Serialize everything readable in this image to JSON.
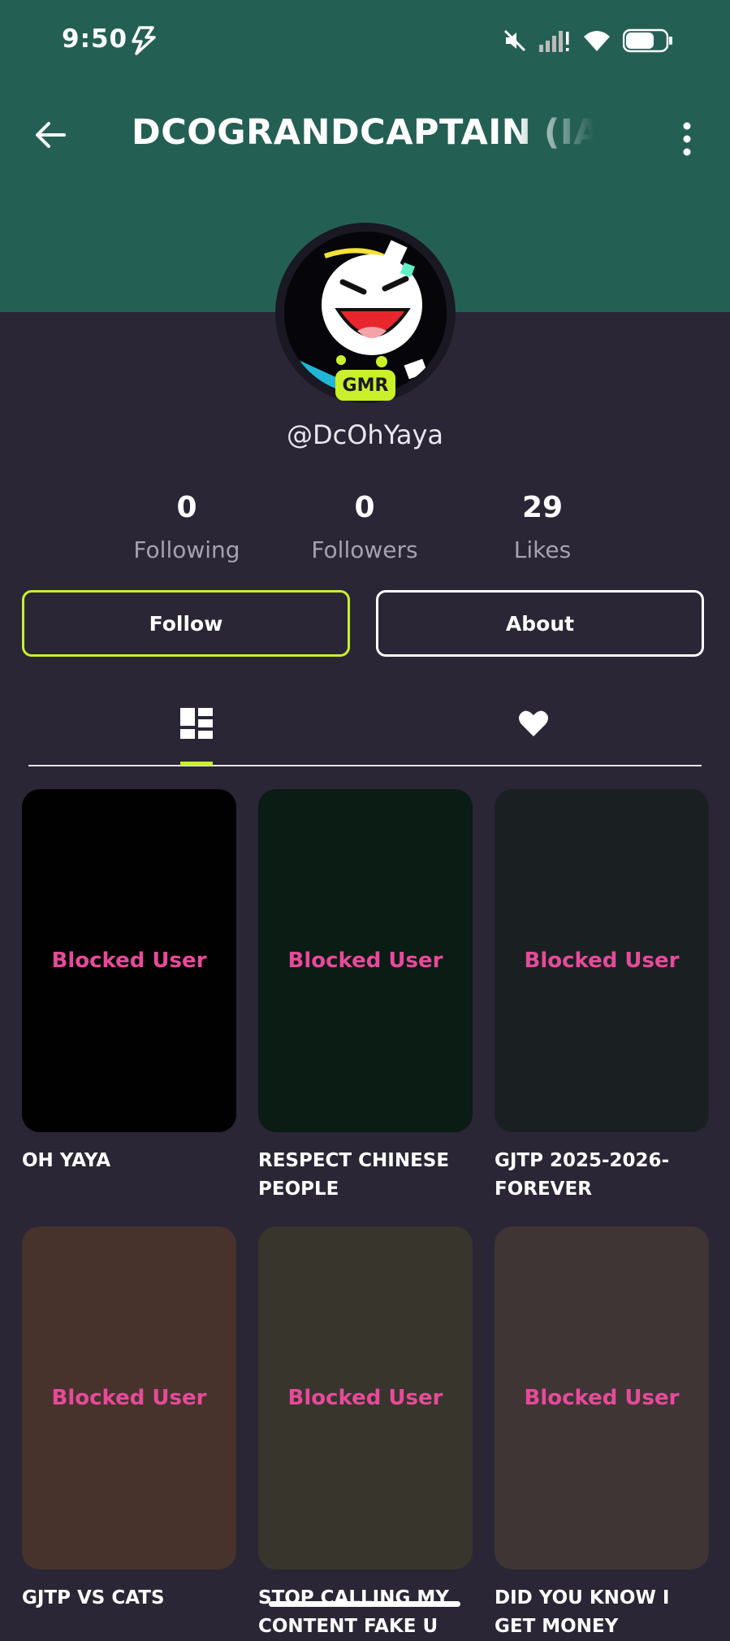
{
  "status": {
    "time": "9:50"
  },
  "header": {
    "title": "DCOGRANDCAPTAIN (IAML"
  },
  "profile": {
    "badge": "GMR",
    "handle": "@DcOhYaya"
  },
  "stats": [
    {
      "value": "0",
      "label": "Following"
    },
    {
      "value": "0",
      "label": "Followers"
    },
    {
      "value": "29",
      "label": "Likes"
    }
  ],
  "actions": {
    "follow": "Follow",
    "about": "About"
  },
  "tabs": [
    {
      "icon": "grid-icon",
      "selected": true
    },
    {
      "icon": "heart-icon",
      "selected": false
    }
  ],
  "colors": {
    "header": "#245f54",
    "background": "#2a2635",
    "accent": "#c9f02a",
    "blocked_text": "#e84a9a"
  },
  "videos": [
    {
      "overlay": "Blocked User",
      "title": "OH YAYA",
      "color": "#010101"
    },
    {
      "overlay": "Blocked User",
      "title": "RESPECT CHINESE PEOPLE",
      "color": "#0a1c14"
    },
    {
      "overlay": "Blocked User",
      "title": "GJTP 2025-2026-FOREVER",
      "color": "#1a2022"
    },
    {
      "overlay": "Blocked User",
      "title": "GJTP VS CATS",
      "color": "#47332b"
    },
    {
      "overlay": "Blocked User",
      "title": "STOP CALLING MY CONTENT FAKE U",
      "color": "#37352c"
    },
    {
      "overlay": "Blocked User",
      "title": "DID YOU KNOW I GET MONEY",
      "color": "#3f3535"
    }
  ]
}
